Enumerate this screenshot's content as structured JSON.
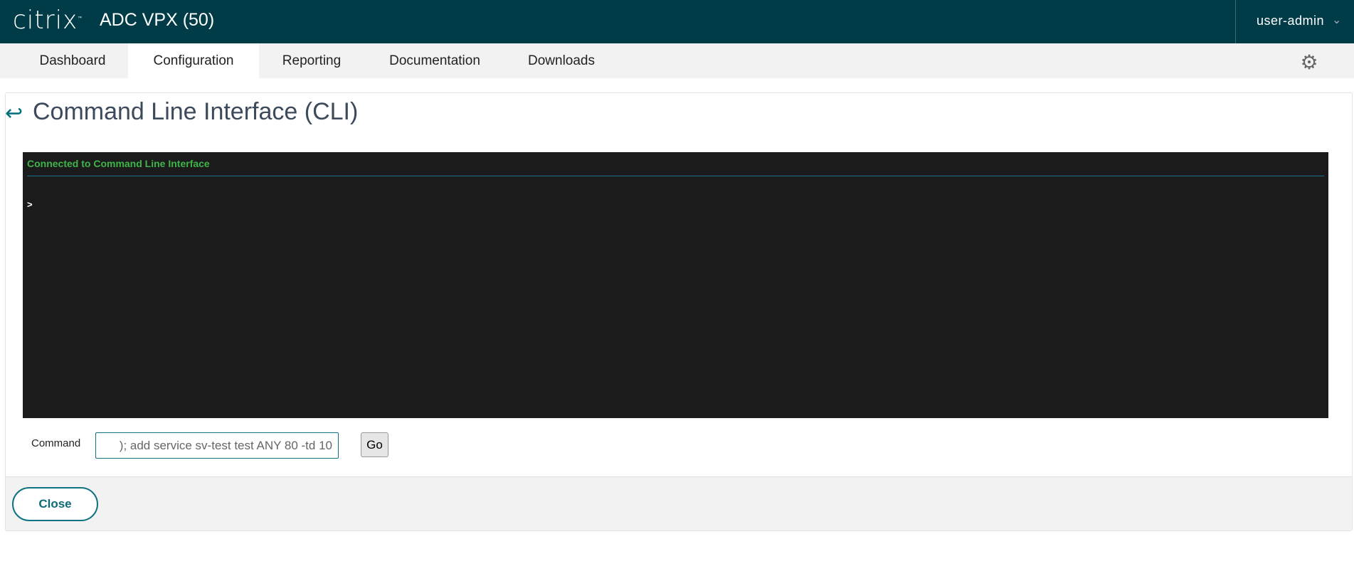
{
  "header": {
    "logo": "citrix",
    "product": "ADC VPX (50)",
    "user": "user-admin"
  },
  "nav": {
    "tabs": [
      {
        "label": "Dashboard"
      },
      {
        "label": "Configuration"
      },
      {
        "label": "Reporting"
      },
      {
        "label": "Documentation"
      },
      {
        "label": "Downloads"
      }
    ],
    "active": "Configuration"
  },
  "page": {
    "title": "Command Line Interface (CLI)"
  },
  "terminal": {
    "status": "Connected to Command Line Interface",
    "prompt": ">"
  },
  "command": {
    "label": "Command",
    "value": "); add service sv-test test ANY 80 -td 10",
    "go_label": "Go"
  },
  "footer": {
    "close_label": "Close"
  },
  "colors": {
    "header": "#003c48",
    "accent": "#0f7383",
    "terminal_bg": "#1b1b1b",
    "status_green": "#3fb449"
  }
}
